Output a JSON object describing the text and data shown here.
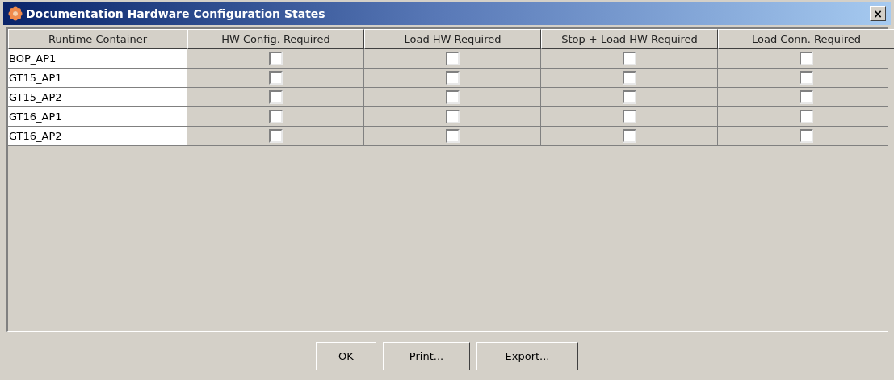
{
  "window": {
    "title": "Documentation Hardware Configuration States",
    "close": "×"
  },
  "table": {
    "columns": [
      "Runtime Container",
      "HW Config. Required",
      "Load HW Required",
      "Stop + Load HW Required",
      "Load Conn. Required"
    ],
    "rows": [
      {
        "name": "BOP_AP1",
        "checks": [
          false,
          false,
          false,
          false
        ]
      },
      {
        "name": "GT15_AP1",
        "checks": [
          false,
          false,
          false,
          false
        ]
      },
      {
        "name": "GT15_AP2",
        "checks": [
          false,
          false,
          false,
          false
        ]
      },
      {
        "name": "GT16_AP1",
        "checks": [
          false,
          false,
          false,
          false
        ]
      },
      {
        "name": "GT16_AP2",
        "checks": [
          false,
          false,
          false,
          false
        ]
      }
    ]
  },
  "buttons": [
    "OK",
    "Print...",
    "Export..."
  ]
}
